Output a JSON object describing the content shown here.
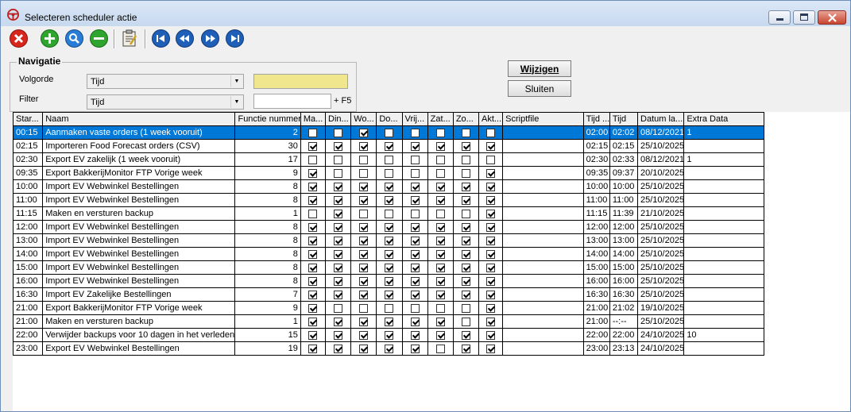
{
  "window": {
    "title": "Selecteren scheduler actie"
  },
  "navigation": {
    "group_title": "Navigatie",
    "order_label": "Volgorde",
    "order_value": "Tijd",
    "filter_label": "Filter",
    "filter_value": "Tijd",
    "search_value": "",
    "filter_input_value": "",
    "f5_hint": "+ F5"
  },
  "buttons": {
    "change": "Wijzigen",
    "close": "Sluiten"
  },
  "table": {
    "columns": [
      "Star...",
      "Naam",
      "Functie nummer",
      "Ma...",
      "Din...",
      "Wo...",
      "Do...",
      "Vrij...",
      "Zat...",
      "Zo...",
      "Akt...",
      "Scriptfile",
      "Tijd ...",
      "Tijd",
      "Datum la...",
      "Extra Data"
    ],
    "rows": [
      {
        "start": "00:15",
        "name": "Aanmaken vaste orders (1 week vooruit)",
        "func": "2",
        "days": [
          0,
          0,
          1,
          0,
          0,
          0,
          0,
          0
        ],
        "script": "",
        "t1": "02:00",
        "t2": "02:02",
        "date": "08/12/2021",
        "extra": "1",
        "selected": true
      },
      {
        "start": "02:15",
        "name": "Importeren Food Forecast orders (CSV)",
        "func": "30",
        "days": [
          1,
          1,
          1,
          1,
          1,
          1,
          1,
          1
        ],
        "script": "",
        "t1": "02:15",
        "t2": "02:15",
        "date": "25/10/2025",
        "extra": ""
      },
      {
        "start": "02:30",
        "name": "Export EV zakelijk (1 week vooruit)",
        "func": "17",
        "days": [
          0,
          0,
          0,
          0,
          0,
          0,
          0,
          0
        ],
        "script": "",
        "t1": "02:30",
        "t2": "02:33",
        "date": "08/12/2021",
        "extra": "1"
      },
      {
        "start": "09:35",
        "name": "Export BakkerijMonitor FTP Vorige week",
        "func": "9",
        "days": [
          1,
          0,
          0,
          0,
          0,
          0,
          0,
          1
        ],
        "script": "",
        "t1": "09:35",
        "t2": "09:37",
        "date": "20/10/2025",
        "extra": ""
      },
      {
        "start": "10:00",
        "name": "Import EV Webwinkel Bestellingen",
        "func": "8",
        "days": [
          1,
          1,
          1,
          1,
          1,
          1,
          1,
          1
        ],
        "script": "",
        "t1": "10:00",
        "t2": "10:00",
        "date": "25/10/2025",
        "extra": ""
      },
      {
        "start": "11:00",
        "name": "Import EV Webwinkel Bestellingen",
        "func": "8",
        "days": [
          1,
          1,
          1,
          1,
          1,
          1,
          1,
          1
        ],
        "script": "",
        "t1": "11:00",
        "t2": "11:00",
        "date": "25/10/2025",
        "extra": ""
      },
      {
        "start": "11:15",
        "name": "Maken en versturen backup",
        "func": "1",
        "days": [
          0,
          1,
          0,
          0,
          0,
          0,
          0,
          1
        ],
        "script": "",
        "t1": "11:15",
        "t2": "11:39",
        "date": "21/10/2025",
        "extra": ""
      },
      {
        "start": "12:00",
        "name": "Import EV Webwinkel Bestellingen",
        "func": "8",
        "days": [
          1,
          1,
          1,
          1,
          1,
          1,
          1,
          1
        ],
        "script": "",
        "t1": "12:00",
        "t2": "12:00",
        "date": "25/10/2025",
        "extra": ""
      },
      {
        "start": "13:00",
        "name": "Import EV Webwinkel Bestellingen",
        "func": "8",
        "days": [
          1,
          1,
          1,
          1,
          1,
          1,
          1,
          1
        ],
        "script": "",
        "t1": "13:00",
        "t2": "13:00",
        "date": "25/10/2025",
        "extra": ""
      },
      {
        "start": "14:00",
        "name": "Import EV Webwinkel Bestellingen",
        "func": "8",
        "days": [
          1,
          1,
          1,
          1,
          1,
          1,
          1,
          1
        ],
        "script": "",
        "t1": "14:00",
        "t2": "14:00",
        "date": "25/10/2025",
        "extra": ""
      },
      {
        "start": "15:00",
        "name": "Import EV Webwinkel Bestellingen",
        "func": "8",
        "days": [
          1,
          1,
          1,
          1,
          1,
          1,
          1,
          1
        ],
        "script": "",
        "t1": "15:00",
        "t2": "15:00",
        "date": "25/10/2025",
        "extra": ""
      },
      {
        "start": "16:00",
        "name": "Import EV Webwinkel Bestellingen",
        "func": "8",
        "days": [
          1,
          1,
          1,
          1,
          1,
          1,
          1,
          1
        ],
        "script": "",
        "t1": "16:00",
        "t2": "16:00",
        "date": "25/10/2025",
        "extra": ""
      },
      {
        "start": "16:30",
        "name": "Import EV Zakelijke Bestellingen",
        "func": "7",
        "days": [
          1,
          1,
          1,
          1,
          1,
          1,
          1,
          1
        ],
        "script": "",
        "t1": "16:30",
        "t2": "16:30",
        "date": "25/10/2025",
        "extra": ""
      },
      {
        "start": "21:00",
        "name": "Export BakkerijMonitor FTP Vorige week",
        "func": "9",
        "days": [
          1,
          0,
          0,
          0,
          0,
          0,
          0,
          1
        ],
        "script": "",
        "t1": "21:00",
        "t2": "21:02",
        "date": "19/10/2025",
        "extra": ""
      },
      {
        "start": "21:00",
        "name": "Maken en versturen backup",
        "func": "1",
        "days": [
          1,
          1,
          1,
          1,
          1,
          1,
          0,
          1
        ],
        "script": "",
        "t1": "21:00",
        "t2": "--:--",
        "date": "25/10/2025",
        "extra": ""
      },
      {
        "start": "22:00",
        "name": "Verwijder backups voor 10 dagen in het verleden",
        "func": "15",
        "days": [
          1,
          1,
          1,
          1,
          1,
          1,
          1,
          1
        ],
        "script": "",
        "t1": "22:00",
        "t2": "22:00",
        "date": "24/10/2025",
        "extra": "10"
      },
      {
        "start": "23:00",
        "name": "Export EV Webwinkel Bestellingen",
        "func": "19",
        "days": [
          1,
          1,
          1,
          1,
          1,
          0,
          1,
          1
        ],
        "script": "",
        "t1": "23:00",
        "t2": "23:13",
        "date": "24/10/2025",
        "extra": ""
      }
    ]
  },
  "colors": {
    "selection": "#0078d7",
    "search_field": "#efe68e",
    "delete": "#d9261c",
    "add": "#2fa52f",
    "nav": "#1f5fb8"
  }
}
